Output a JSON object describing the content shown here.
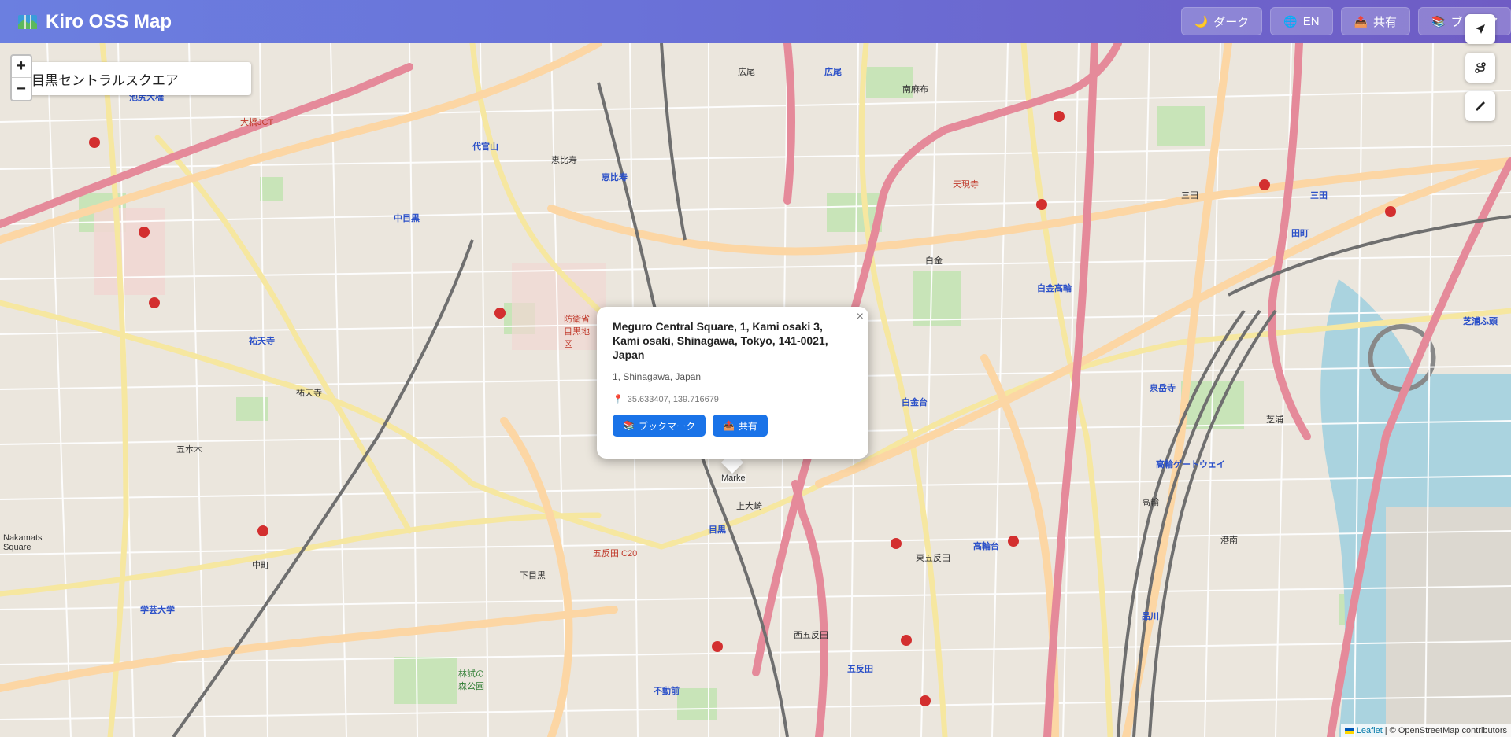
{
  "app": {
    "title": "Kiro OSS Map",
    "icon": "map-icon"
  },
  "header": {
    "buttons": [
      {
        "icon": "moon-icon",
        "label": "ダーク"
      },
      {
        "icon": "globe-icon",
        "label": "EN"
      },
      {
        "icon": "share-icon",
        "label": "共有"
      },
      {
        "icon": "bookmark-icon",
        "label": "ブックマ"
      }
    ]
  },
  "search": {
    "value": "目黒セントラルスクエア"
  },
  "zoom": {
    "in": "+",
    "out": "−"
  },
  "popup": {
    "title": "Meguro Central Square, 1, Kami osaki 3, Kami osaki, Shinagawa, Tokyo, 141-0021, Japan",
    "subtitle": "1, Shinagawa, Japan",
    "coords": "35.633407, 139.716679",
    "close": "×",
    "actions": [
      {
        "icon": "bookmark-icon",
        "label": "ブックマーク"
      },
      {
        "icon": "share-icon",
        "label": "共有"
      }
    ]
  },
  "marker": {
    "label": "Marke"
  },
  "map_labels": [
    {
      "text": "池尻大橋",
      "kind": "blue"
    },
    {
      "text": "代官山",
      "kind": "blue"
    },
    {
      "text": "恵比寿",
      "kind": "blue"
    },
    {
      "text": "広尾",
      "kind": "blue"
    },
    {
      "text": "中目黒",
      "kind": "blue"
    },
    {
      "text": "祐天寺",
      "kind": "blue"
    },
    {
      "text": "学芸大学",
      "kind": "blue"
    },
    {
      "text": "目黒",
      "kind": "blue"
    },
    {
      "text": "不動前",
      "kind": "blue"
    },
    {
      "text": "五反田",
      "kind": "blue"
    },
    {
      "text": "白金台",
      "kind": "blue"
    },
    {
      "text": "白金高輪",
      "kind": "blue"
    },
    {
      "text": "高輪台",
      "kind": "blue"
    },
    {
      "text": "品川",
      "kind": "blue"
    },
    {
      "text": "田町",
      "kind": "blue"
    },
    {
      "text": "三田",
      "kind": "blue"
    },
    {
      "text": "泉岳寺",
      "kind": "blue"
    },
    {
      "text": "高輪ゲートウェイ",
      "kind": "blue"
    },
    {
      "text": "芝浦ふ頭",
      "kind": "blue"
    },
    {
      "text": "大橋JCT",
      "kind": "red"
    },
    {
      "text": "天現寺",
      "kind": "red"
    },
    {
      "text": "五反田 C20",
      "kind": "red"
    },
    {
      "text": "恵比寿",
      "kind": "plain"
    },
    {
      "text": "広尾",
      "kind": "plain"
    },
    {
      "text": "南麻布",
      "kind": "plain"
    },
    {
      "text": "白金",
      "kind": "plain"
    },
    {
      "text": "上大崎",
      "kind": "plain"
    },
    {
      "text": "下目黒",
      "kind": "plain"
    },
    {
      "text": "中町",
      "kind": "plain"
    },
    {
      "text": "五本木",
      "kind": "plain"
    },
    {
      "text": "祐天寺",
      "kind": "plain"
    },
    {
      "text": "三田",
      "kind": "plain"
    },
    {
      "text": "高輪",
      "kind": "plain"
    },
    {
      "text": "港南",
      "kind": "plain"
    },
    {
      "text": "芝浦",
      "kind": "plain"
    },
    {
      "text": "西五反田",
      "kind": "plain"
    },
    {
      "text": "東五反田",
      "kind": "plain"
    },
    {
      "text": "Nakamats Square",
      "kind": "plain"
    },
    {
      "text": "防衛省目黒地区",
      "kind": "red"
    },
    {
      "text": "林試の森公園",
      "kind": "plain"
    }
  ],
  "attribution": {
    "leaflet": "Leaflet",
    "sep": "|",
    "osm": "© OpenStreetMap contributors"
  }
}
